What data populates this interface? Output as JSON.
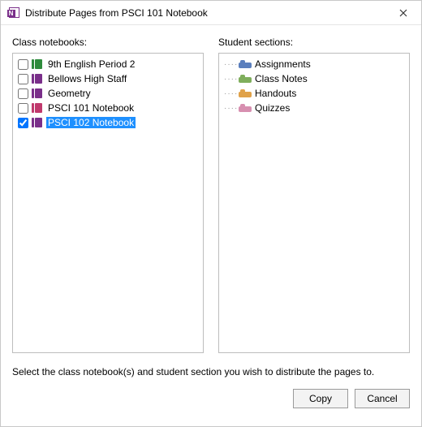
{
  "window": {
    "title": "Distribute Pages from PSCI 101 Notebook"
  },
  "labels": {
    "class_notebooks": "Class notebooks:",
    "student_sections": "Student sections:",
    "helper": "Select the class notebook(s) and student section you wish to distribute the pages to."
  },
  "buttons": {
    "copy": "Copy",
    "cancel": "Cancel"
  },
  "colors": {
    "notebook_green": "#2e8b3c",
    "notebook_purple": "#7a2f8a",
    "notebook_magenta": "#c0396d",
    "section_blue": "#5b7fbd",
    "section_green": "#7fae5c",
    "section_orange": "#e0a24a",
    "section_pink": "#d78fb0"
  },
  "class_notebooks": [
    {
      "label": "9th English  Period 2",
      "checked": false,
      "color_key": "notebook_green",
      "selected": false
    },
    {
      "label": "Bellows High Staff",
      "checked": false,
      "color_key": "notebook_purple",
      "selected": false
    },
    {
      "label": "Geometry",
      "checked": false,
      "color_key": "notebook_purple",
      "selected": false
    },
    {
      "label": "PSCI 101 Notebook",
      "checked": false,
      "color_key": "notebook_magenta",
      "selected": false
    },
    {
      "label": "PSCI 102 Notebook",
      "checked": true,
      "color_key": "notebook_purple",
      "selected": true
    }
  ],
  "student_sections": [
    {
      "label": "Assignments",
      "color_key": "section_blue"
    },
    {
      "label": "Class Notes",
      "color_key": "section_green"
    },
    {
      "label": "Handouts",
      "color_key": "section_orange"
    },
    {
      "label": "Quizzes",
      "color_key": "section_pink"
    }
  ]
}
